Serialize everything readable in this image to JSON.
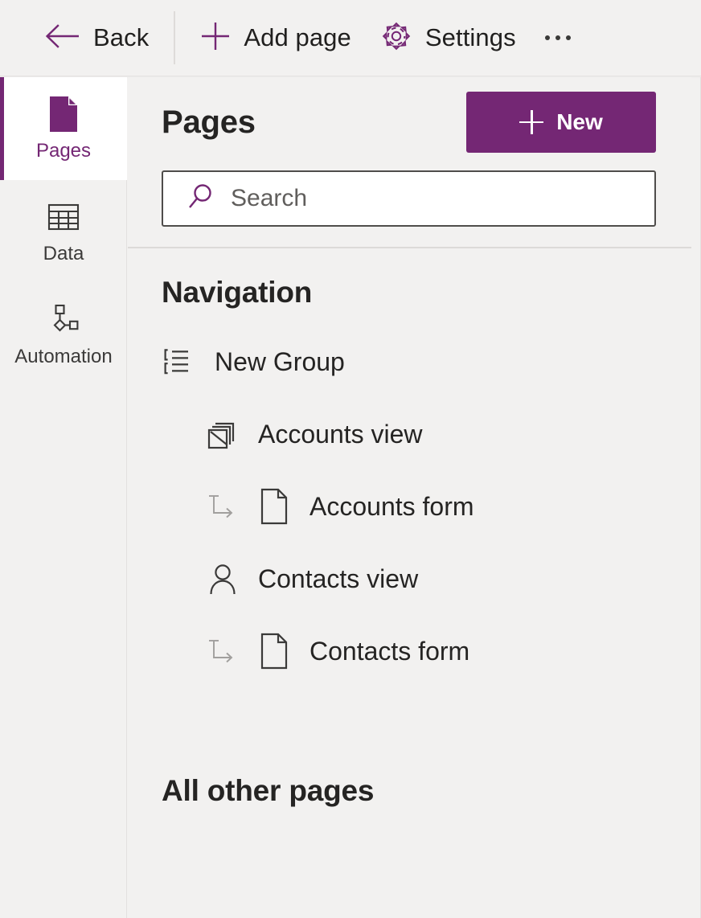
{
  "commandbar": {
    "items": [
      {
        "label": "Back",
        "icon": "arrow-left-icon"
      },
      {
        "label": "Add page",
        "icon": "plus-icon"
      },
      {
        "label": "Settings",
        "icon": "gear-icon"
      }
    ],
    "overflow": {
      "name": "more-options",
      "glyph": "..."
    }
  },
  "rail": {
    "items": [
      {
        "label": "Pages",
        "icon": "page-icon",
        "selected": true
      },
      {
        "label": "Data",
        "icon": "table-icon",
        "selected": false
      },
      {
        "label": "Automation",
        "icon": "flow-icon",
        "selected": false
      }
    ]
  },
  "pane": {
    "title": "Pages",
    "new_button": "New",
    "search": {
      "value": "",
      "placeholder": "Search",
      "icon": "search-icon"
    },
    "navigation": {
      "heading": "Navigation",
      "tree": [
        {
          "label": "New Group",
          "icon": "group-list-icon",
          "level": 0,
          "connector": false
        },
        {
          "label": "Accounts view",
          "icon": "view-pages-icon",
          "level": 1,
          "connector": false
        },
        {
          "label": "Accounts form",
          "icon": "form-page-icon",
          "level": 2,
          "connector": true
        },
        {
          "label": "Contacts view",
          "icon": "person-icon",
          "level": 1,
          "connector": false
        },
        {
          "label": "Contacts form",
          "icon": "form-page-icon",
          "level": 2,
          "connector": true
        }
      ]
    },
    "other_pages": {
      "heading": "All other pages"
    }
  },
  "colors": {
    "accent": "#742774",
    "surface": "#f2f1f0",
    "selected_surface": "#ffffff",
    "text": "#252423",
    "muted_text": "#605e5c",
    "divider": "#dcdad8"
  }
}
